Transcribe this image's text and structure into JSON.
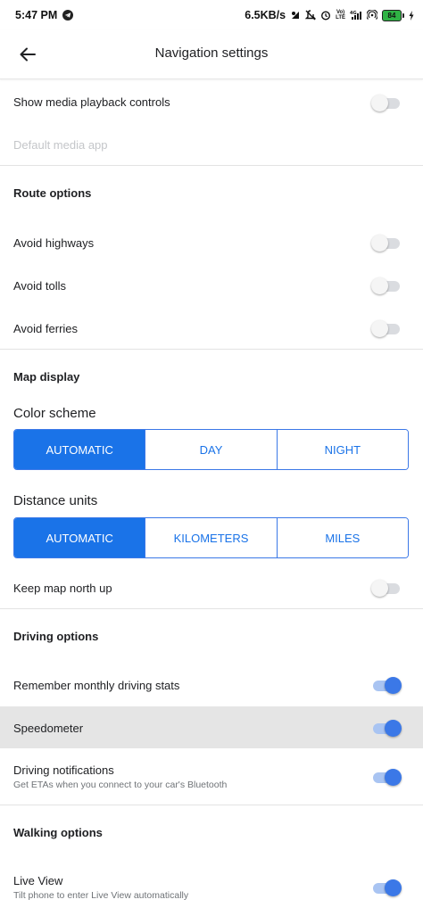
{
  "status_bar": {
    "time": "5:47 PM",
    "net_speed": "6.5KB/s",
    "network": "4G",
    "volte_line1": "Vo)",
    "volte_line2": "LTE",
    "battery": "84"
  },
  "header": {
    "title": "Navigation settings"
  },
  "media": {
    "show_controls_label": "Show media playback controls",
    "show_controls_on": false,
    "default_app_label": "Default media app"
  },
  "route_options": {
    "title": "Route options",
    "items": [
      {
        "label": "Avoid highways",
        "on": false
      },
      {
        "label": "Avoid tolls",
        "on": false
      },
      {
        "label": "Avoid ferries",
        "on": false
      }
    ]
  },
  "map_display": {
    "title": "Map display",
    "color_scheme": {
      "label": "Color scheme",
      "options": [
        "AUTOMATIC",
        "DAY",
        "NIGHT"
      ],
      "selected": "AUTOMATIC"
    },
    "distance_units": {
      "label": "Distance units",
      "options": [
        "AUTOMATIC",
        "KILOMETERS",
        "MILES"
      ],
      "selected": "AUTOMATIC"
    },
    "north_up_label": "Keep map north up",
    "north_up_on": false
  },
  "driving_options": {
    "title": "Driving options",
    "items": [
      {
        "label": "Remember monthly driving stats",
        "subtitle": "",
        "on": true
      },
      {
        "label": "Speedometer",
        "subtitle": "",
        "on": true
      },
      {
        "label": "Driving notifications",
        "subtitle": "Get ETAs when you connect to your car's Bluetooth",
        "on": true
      }
    ]
  },
  "walking_options": {
    "title": "Walking options",
    "items": [
      {
        "label": "Live View",
        "subtitle": "Tilt phone to enter Live View automatically",
        "on": true
      }
    ]
  },
  "colors": {
    "accent": "#1a73e8",
    "toggle_on_thumb": "#3b78e7",
    "toggle_on_track": "#a9c4f2",
    "toggle_off_track": "#dadce0",
    "highlight_row": "#e5e5e5"
  }
}
